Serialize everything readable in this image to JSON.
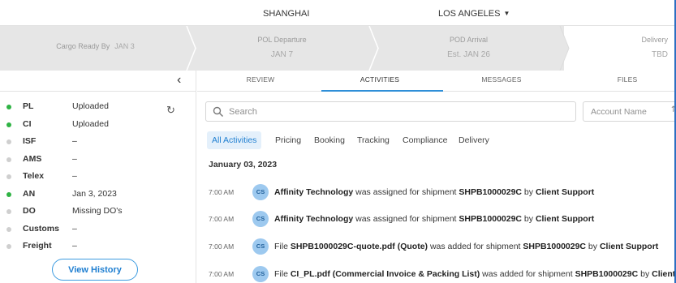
{
  "route": {
    "origin": "SHANGHAI",
    "destination": "LOS ANGELES"
  },
  "milestones": {
    "cargo_ready": {
      "label": "Cargo Ready By",
      "value": "JAN 3"
    },
    "pol": {
      "label": "POL Departure",
      "value": "JAN 7"
    },
    "pod": {
      "label": "POD Arrival",
      "value": "Est. JAN 26"
    },
    "delivery": {
      "label": "Delivery",
      "value": "TBD"
    }
  },
  "documents": [
    {
      "name": "PL",
      "status": "Uploaded",
      "state": "green"
    },
    {
      "name": "CI",
      "status": "Uploaded",
      "state": "green"
    },
    {
      "name": "ISF",
      "status": "–",
      "state": "grey"
    },
    {
      "name": "AMS",
      "status": "–",
      "state": "grey"
    },
    {
      "name": "Telex",
      "status": "–",
      "state": "grey"
    },
    {
      "name": "AN",
      "status": "Jan 3, 2023",
      "state": "green"
    },
    {
      "name": "DO",
      "status": "Missing DO's",
      "state": "grey"
    },
    {
      "name": "Customs",
      "status": "–",
      "state": "grey"
    },
    {
      "name": "Freight",
      "status": "–",
      "state": "grey"
    }
  ],
  "view_history_label": "View History",
  "tabs": {
    "review": "REVIEW",
    "activities": "ACTIVITIES",
    "messages": "MESSAGES",
    "files": "FILES"
  },
  "search": {
    "placeholder": "Search",
    "account_placeholder": "Account Name"
  },
  "filters": [
    "All Activities",
    "Pricing",
    "Booking",
    "Tracking",
    "Compliance",
    "Delivery"
  ],
  "active_filter": "All Activities",
  "date_header": "January 03, 2023",
  "activities": [
    {
      "time": "7:00 AM",
      "initials": "CS",
      "pre": "",
      "subject": "Affinity Technology",
      "mid": " was assigned for shipment ",
      "shipment": "SHPB1000029C",
      "by": " by ",
      "actor": "Client Support"
    },
    {
      "time": "7:00 AM",
      "initials": "CS",
      "pre": "",
      "subject": "Affinity Technology",
      "mid": " was assigned for shipment ",
      "shipment": "SHPB1000029C",
      "by": " by ",
      "actor": "Client Support"
    },
    {
      "time": "7:00 AM",
      "initials": "CS",
      "pre": "File ",
      "subject": "SHPB1000029C-quote.pdf (Quote)",
      "mid": " was added for shipment ",
      "shipment": "SHPB1000029C",
      "by": " by ",
      "actor": "Client Support"
    },
    {
      "time": "7:00 AM",
      "initials": "CS",
      "pre": "File ",
      "subject": "CI_PL.pdf (Commercial Invoice & Packing List)",
      "mid": " was added for shipment ",
      "shipment": "SHPB1000029C",
      "by": " by ",
      "actor": "Client Support"
    }
  ],
  "colors": {
    "accent": "#2f8fd8",
    "status_green": "#2fb344",
    "status_grey": "#cfcfcf",
    "frame_blue": "#2d6fc1"
  }
}
